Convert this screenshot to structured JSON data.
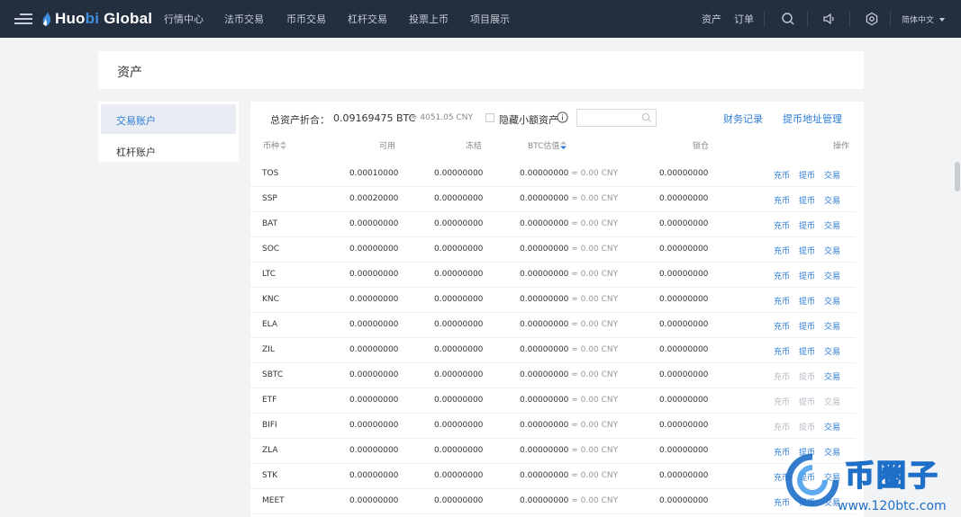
{
  "nav": {
    "logo_main": "Huo",
    "logo_accent": "bi",
    "logo_rest": " Global",
    "items": [
      "行情中心",
      "法币交易",
      "币币交易",
      "杠杆交易",
      "投票上币",
      "项目展示"
    ],
    "assets": "资产",
    "orders": "订单",
    "language": "简体中文"
  },
  "page": {
    "title": "资产"
  },
  "sidebar": {
    "items": [
      {
        "label": "交易账户",
        "active": true
      },
      {
        "label": "杠杆账户",
        "active": false
      }
    ]
  },
  "summary": {
    "label": "总资产折合：",
    "btc": "0.09169475 BTC",
    "cny": "≈ 4051.05 CNY",
    "hide_small": "隐藏小额资产",
    "search_placeholder": "",
    "records_link": "财务记录",
    "address_link": "提币地址管理"
  },
  "table": {
    "headers": {
      "coin": "币种",
      "available": "可用",
      "frozen": "冻结",
      "btc_value": "BTC估值",
      "locked": "锁仓",
      "actions": "操作"
    },
    "action_labels": {
      "deposit": "充币",
      "withdraw": "提币",
      "trade": "交易"
    },
    "rows": [
      {
        "coin": "TOS",
        "available": "0.00010000",
        "frozen": "0.00000000",
        "btc": "0.00000000",
        "cny": "≈ 0.00 CNY",
        "locked": "0.00000000",
        "deposit_enabled": true,
        "withdraw_enabled": true,
        "trade_enabled": true
      },
      {
        "coin": "SSP",
        "available": "0.00020000",
        "frozen": "0.00000000",
        "btc": "0.00000000",
        "cny": "≈ 0.00 CNY",
        "locked": "0.00000000",
        "deposit_enabled": true,
        "withdraw_enabled": true,
        "trade_enabled": true
      },
      {
        "coin": "BAT",
        "available": "0.00000000",
        "frozen": "0.00000000",
        "btc": "0.00000000",
        "cny": "≈ 0.00 CNY",
        "locked": "0.00000000",
        "deposit_enabled": true,
        "withdraw_enabled": true,
        "trade_enabled": true
      },
      {
        "coin": "SOC",
        "available": "0.00000000",
        "frozen": "0.00000000",
        "btc": "0.00000000",
        "cny": "≈ 0.00 CNY",
        "locked": "0.00000000",
        "deposit_enabled": true,
        "withdraw_enabled": true,
        "trade_enabled": true
      },
      {
        "coin": "LTC",
        "available": "0.00000000",
        "frozen": "0.00000000",
        "btc": "0.00000000",
        "cny": "≈ 0.00 CNY",
        "locked": "0.00000000",
        "deposit_enabled": true,
        "withdraw_enabled": true,
        "trade_enabled": true
      },
      {
        "coin": "KNC",
        "available": "0.00000000",
        "frozen": "0.00000000",
        "btc": "0.00000000",
        "cny": "≈ 0.00 CNY",
        "locked": "0.00000000",
        "deposit_enabled": true,
        "withdraw_enabled": true,
        "trade_enabled": true
      },
      {
        "coin": "ELA",
        "available": "0.00000000",
        "frozen": "0.00000000",
        "btc": "0.00000000",
        "cny": "≈ 0.00 CNY",
        "locked": "0.00000000",
        "deposit_enabled": true,
        "withdraw_enabled": true,
        "trade_enabled": true
      },
      {
        "coin": "ZIL",
        "available": "0.00000000",
        "frozen": "0.00000000",
        "btc": "0.00000000",
        "cny": "≈ 0.00 CNY",
        "locked": "0.00000000",
        "deposit_enabled": true,
        "withdraw_enabled": true,
        "trade_enabled": true
      },
      {
        "coin": "SBTC",
        "available": "0.00000000",
        "frozen": "0.00000000",
        "btc": "0.00000000",
        "cny": "≈ 0.00 CNY",
        "locked": "0.00000000",
        "deposit_enabled": false,
        "withdraw_enabled": false,
        "trade_enabled": true
      },
      {
        "coin": "ETF",
        "available": "0.00000000",
        "frozen": "0.00000000",
        "btc": "0.00000000",
        "cny": "≈ 0.00 CNY",
        "locked": "0.00000000",
        "deposit_enabled": false,
        "withdraw_enabled": false,
        "trade_enabled": false
      },
      {
        "coin": "BIFI",
        "available": "0.00000000",
        "frozen": "0.00000000",
        "btc": "0.00000000",
        "cny": "≈ 0.00 CNY",
        "locked": "0.00000000",
        "deposit_enabled": false,
        "withdraw_enabled": false,
        "trade_enabled": true
      },
      {
        "coin": "ZLA",
        "available": "0.00000000",
        "frozen": "0.00000000",
        "btc": "0.00000000",
        "cny": "≈ 0.00 CNY",
        "locked": "0.00000000",
        "deposit_enabled": true,
        "withdraw_enabled": true,
        "trade_enabled": true
      },
      {
        "coin": "STK",
        "available": "0.00000000",
        "frozen": "0.00000000",
        "btc": "0.00000000",
        "cny": "≈ 0.00 CNY",
        "locked": "0.00000000",
        "deposit_enabled": true,
        "withdraw_enabled": true,
        "trade_enabled": true
      },
      {
        "coin": "MEET",
        "available": "0.00000000",
        "frozen": "0.00000000",
        "btc": "0.00000000",
        "cny": "≈ 0.00 CNY",
        "locked": "0.00000000",
        "deposit_enabled": true,
        "withdraw_enabled": true,
        "trade_enabled": true
      }
    ]
  },
  "watermark": {
    "text": "币圈子",
    "url": "www.120btc.com"
  },
  "colors": {
    "nav_bg": "#232e3e",
    "accent": "#2c7cd6",
    "disabled": "#b5bac2",
    "watermark": "#1e6fc8"
  },
  "icons": [
    "menu-icon",
    "huobi-flame-icon",
    "user-icon",
    "speaker-icon",
    "settings-gear-icon",
    "caret-down-icon",
    "info-icon",
    "search-icon",
    "sort-icon"
  ]
}
